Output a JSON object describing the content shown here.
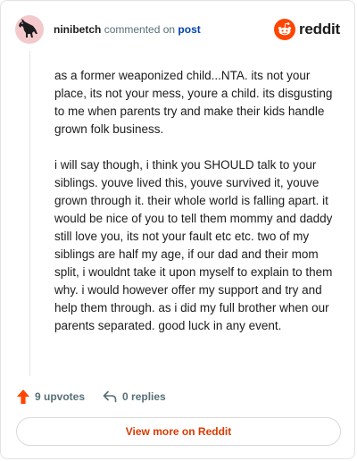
{
  "header": {
    "username": "ninibetch",
    "action_text": "commented on",
    "post_link": "post",
    "brand": "reddit"
  },
  "comment": {
    "paragraphs": [
      "as a former weaponized child...NTA. its not your place, its not your mess, youre a child. its disgusting to me when parents try and make their kids handle grown folk business.",
      "i will say though, i think you SHOULD talk to your siblings. youve lived this, youve survived it, youve grown through it. their whole world is falling apart. it would be nice of you to tell them mommy and daddy still love you, its not your fault etc etc. two of my siblings are half my age, if our dad and their mom split, i wouldnt take it upon myself to explain to them why. i would however offer my support and try and help them through. as i did my full brother when our parents separated. good luck in any event."
    ]
  },
  "actions": {
    "upvotes": "9 upvotes",
    "replies": "0 replies"
  },
  "footer": {
    "view_more": "View more on Reddit"
  },
  "colors": {
    "brand_orange": "#ff4500",
    "upvote": "#ff4500",
    "link_blue": "#0045ac",
    "view_more": "#d93a00"
  },
  "icons": {
    "avatar": "avatar-dinosaur-icon",
    "brand": "reddit-snoo-icon",
    "upvote": "upvote-arrow-icon",
    "reply": "reply-arrow-icon"
  }
}
